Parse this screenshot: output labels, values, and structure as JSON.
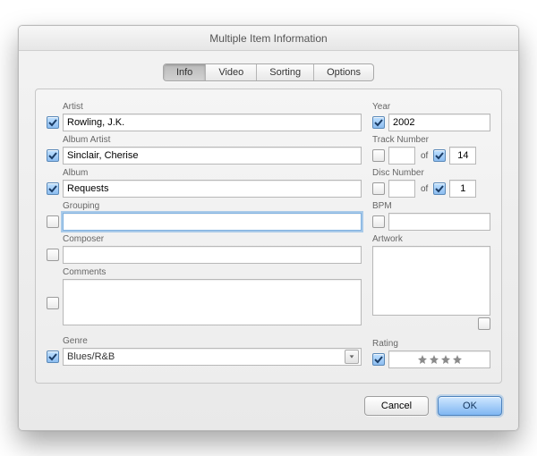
{
  "window": {
    "title": "Multiple Item Information"
  },
  "tabs": {
    "info": {
      "label": "Info",
      "selected": true
    },
    "video": {
      "label": "Video",
      "selected": false
    },
    "sorting": {
      "label": "Sorting",
      "selected": false
    },
    "options": {
      "label": "Options",
      "selected": false
    }
  },
  "labels": {
    "artist": "Artist",
    "album_artist": "Album Artist",
    "album": "Album",
    "grouping": "Grouping",
    "composer": "Composer",
    "comments": "Comments",
    "genre": "Genre",
    "year": "Year",
    "track_number": "Track Number",
    "disc_number": "Disc Number",
    "bpm": "BPM",
    "artwork": "Artwork",
    "rating": "Rating",
    "of": "of"
  },
  "fields": {
    "artist": {
      "checked": true,
      "value": "Rowling, J.K."
    },
    "album_artist": {
      "checked": true,
      "value": "Sinclair, Cherise"
    },
    "album": {
      "checked": true,
      "value": "Requests"
    },
    "grouping": {
      "checked": false,
      "value": ""
    },
    "composer": {
      "checked": false,
      "value": ""
    },
    "comments": {
      "checked": false,
      "value": ""
    },
    "genre": {
      "checked": true,
      "value": "Blues/R&B"
    },
    "year": {
      "checked": true,
      "value": "2002"
    },
    "track_number": {
      "checked": false,
      "value": ""
    },
    "track_total": {
      "checked": true,
      "value": "14"
    },
    "disc_number": {
      "checked": false,
      "value": ""
    },
    "disc_total": {
      "checked": true,
      "value": "1"
    },
    "bpm": {
      "checked": false,
      "value": ""
    },
    "artwork": {
      "checked": false
    },
    "rating": {
      "checked": true,
      "stars": 4
    }
  },
  "buttons": {
    "cancel": "Cancel",
    "ok": "OK"
  }
}
